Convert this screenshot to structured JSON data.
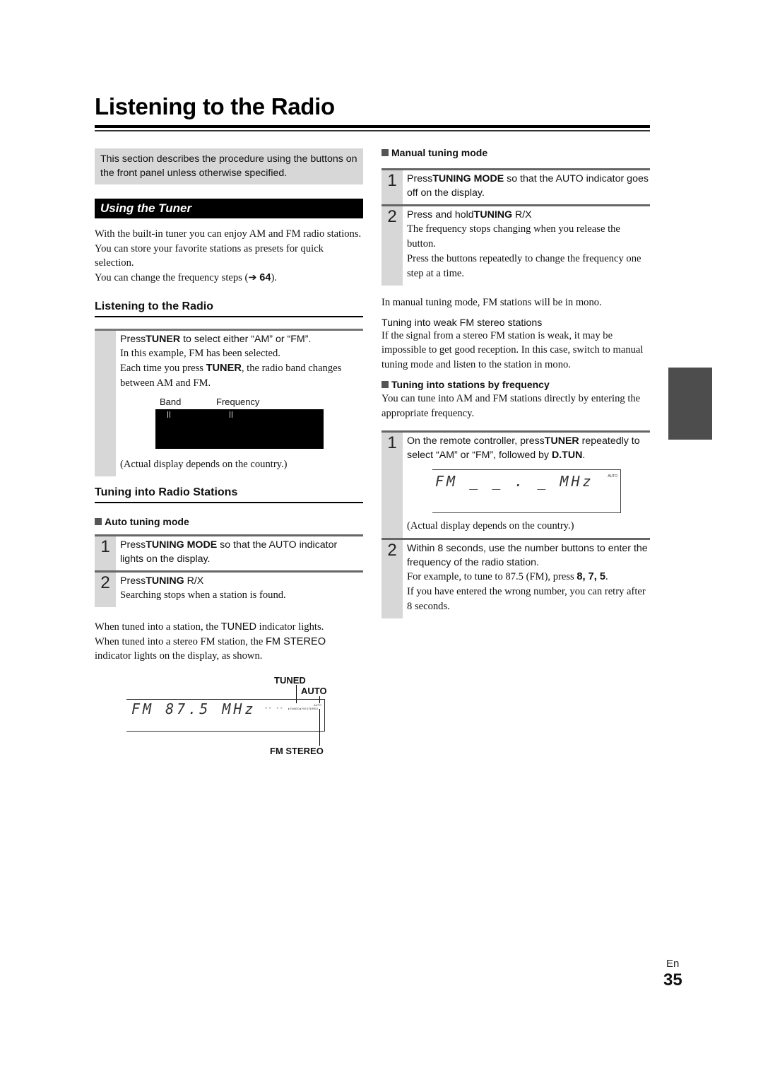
{
  "page": {
    "title": "Listening to the Radio",
    "language": "En",
    "number": "35"
  },
  "left": {
    "note": "This section describes the procedure using the buttons on the front panel unless otherwise specified.",
    "section_title": "Using the Tuner",
    "intro_1": "With the built-in tuner you can enjoy AM and FM radio stations. You can store your favorite stations as presets for quick selection.",
    "intro_2_pre": "You can change the frequency steps (",
    "intro_2_arrow": "➔",
    "intro_2_ref": "64",
    "intro_2_post": ").",
    "listening_head": "Listening to the Radio",
    "listen_step": {
      "main_pre": "Press",
      "main_bold": "TUNER",
      "main_post": " to select either “AM” or “FM”.",
      "sub_1": "In this example, FM has been selected.",
      "sub_2_pre": "Each time you press ",
      "sub_2_bold": "TUNER",
      "sub_2_post": ", the radio band changes between AM and FM.",
      "label_band": "Band",
      "label_frequency": "Frequency",
      "caption": "(Actual display depends on the country.)"
    },
    "tuning_head": "Tuning into Radio Stations",
    "auto_head": "Auto tuning mode",
    "auto_steps": [
      {
        "num": "1",
        "pre": "Press",
        "bold": "TUNING MODE",
        "post": " so that the AUTO indicator lights on the display.",
        "sub": ""
      },
      {
        "num": "2",
        "pre": "Press",
        "bold": "TUNING",
        "post": " R/X",
        "sub": "Searching stops when a station is found."
      }
    ],
    "tuned_text_1_pre": "When tuned into a station, the ",
    "tuned_text_1_sans": "TUNED",
    "tuned_text_1_post": " indicator lights.",
    "tuned_text_2_pre": "When tuned into a stereo FM station, the ",
    "tuned_text_2_sans": "FM STEREO",
    "tuned_text_3": "indicator lights on the display, as shown.",
    "display": {
      "readout": "FM 87.5 MHz",
      "dashes": "-- --",
      "small_indicators": "▸TUNED◂ FM STEREO",
      "small_auto": "AUTO",
      "callout_tuned": "TUNED",
      "callout_auto": "AUTO",
      "callout_fmstereo": "FM STEREO"
    }
  },
  "right": {
    "manual_head": "Manual tuning mode",
    "manual_steps": [
      {
        "num": "1",
        "pre": "Press",
        "bold": "TUNING MODE",
        "post": " so that the AUTO indicator goes off on the display.",
        "subs": []
      },
      {
        "num": "2",
        "pre": "Press and hold",
        "bold": "TUNING",
        "post": " R/X",
        "subs": [
          "The frequency stops changing when you release the button.",
          "Press the buttons repeatedly to change the frequency one step at a time."
        ]
      }
    ],
    "mono_note": "In manual tuning mode, FM stations will be in mono.",
    "weak_head": "Tuning into weak FM stereo stations",
    "weak_text": "If the signal from a stereo FM station is weak, it may be impossible to get good reception. In this case, switch to manual tuning mode and listen to the station in mono.",
    "freq_head": "Tuning into stations by frequency",
    "freq_text": "You can tune into AM and FM stations directly by entering the appropriate frequency.",
    "freq_step_1": {
      "num": "1",
      "pre": "On the remote controller, press",
      "bold1": "TUNER",
      "mid": " repeatedly to select “AM” or “FM”, followed by ",
      "bold2": "D.TUN",
      "post": ".",
      "display_readout": "FM _ _ . _  MHz",
      "display_auto": "AUTO",
      "caption": "(Actual display depends on the country.)"
    },
    "freq_step_2": {
      "num": "2",
      "main": "Within 8 seconds, use the number buttons to enter the frequency of the radio station.",
      "sub_1_pre": "For example, to tune to 87.5 (FM), press ",
      "sub_1_keys": "8, 7, 5",
      "sub_1_post": ".",
      "sub_2": "If you have entered the wrong number, you can retry after 8 seconds."
    }
  }
}
